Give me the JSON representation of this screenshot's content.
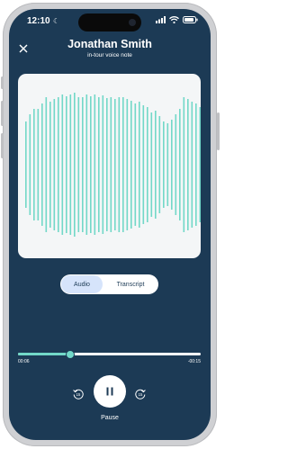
{
  "status_bar": {
    "time": "12:10"
  },
  "header": {
    "close_icon": "close-icon",
    "title": "Jonathan Smith",
    "subtitle": "in-tour voice note"
  },
  "waveform": {
    "bar_color": "#72d8c8",
    "card_color": "#f4f6f7"
  },
  "tabs": {
    "audio_label": "Audio",
    "transcript_label": "Transcript",
    "selected": "Audio"
  },
  "player": {
    "elapsed": "00:06",
    "remaining": "-00:15",
    "progress": 0.28,
    "pause_label": "Pause",
    "rewind_icon": "rewind-15-icon",
    "forward_icon": "forward-15-icon",
    "pause_icon": "pause-icon"
  },
  "colors": {
    "background": "#1c3a55",
    "accent": "#72d8c8",
    "tab_selected": "#d6e4fb"
  }
}
